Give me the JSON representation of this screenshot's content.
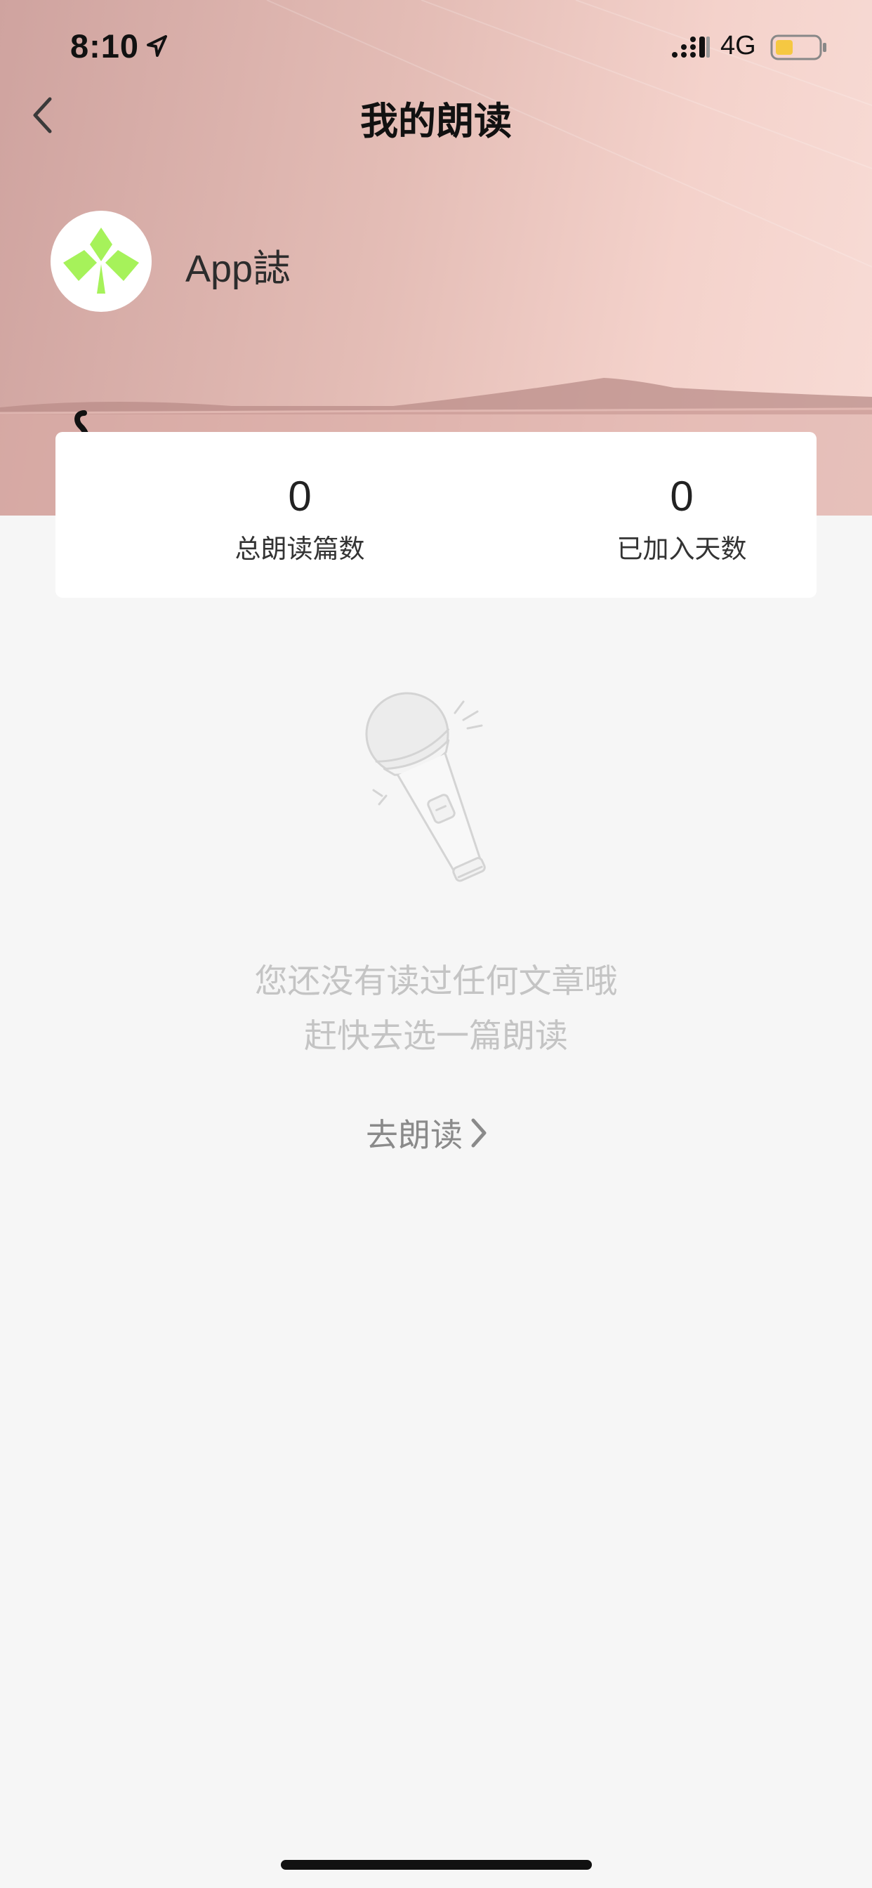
{
  "status_bar": {
    "time": "8:10",
    "network": "4G",
    "icons": [
      "location-arrow-icon",
      "signal-icon",
      "battery-icon"
    ],
    "battery_color": "#f5c842"
  },
  "nav": {
    "title": "我的朗读",
    "back_icon": "chevron-left-icon"
  },
  "profile": {
    "name": "App誌",
    "avatar_icon": "clover-logo-icon",
    "avatar_color": "#a6f25a"
  },
  "stats": {
    "total_articles": {
      "value": "0",
      "label": "总朗读篇数"
    },
    "joined_days": {
      "value": "0",
      "label": "已加入天数"
    }
  },
  "empty_state": {
    "illustration": "microphone-icon",
    "line1": "您还没有读过任何文章哦",
    "line2": "赶快去选一篇朗读",
    "action_label": "去朗读",
    "action_icon": "chevron-right-icon"
  },
  "colors": {
    "hero_gradient_start": "#cfa39f",
    "hero_gradient_end": "#f8dcd6",
    "page_background": "#f6f6f6",
    "card_background": "#ffffff"
  }
}
